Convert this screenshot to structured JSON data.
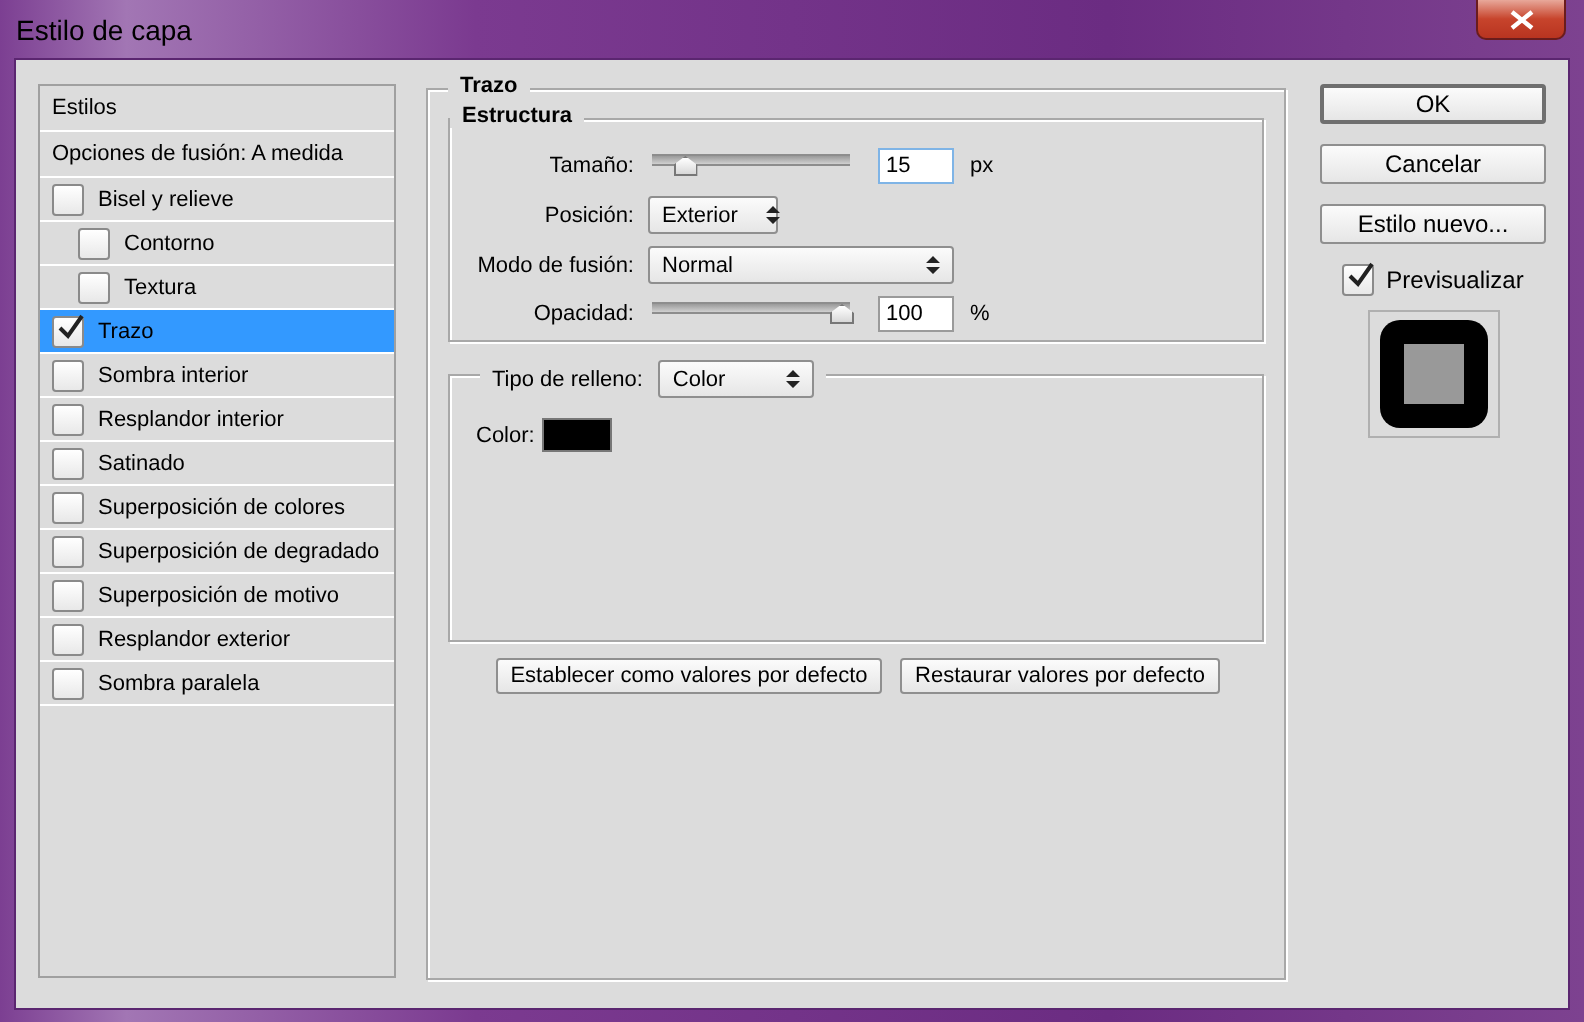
{
  "window": {
    "title": "Estilo de capa"
  },
  "styles_list": {
    "items": [
      {
        "kind": "header",
        "label": "Estilos",
        "selected": false
      },
      {
        "kind": "plain",
        "label": "Opciones de fusión: A medida",
        "selected": false
      },
      {
        "kind": "check",
        "label": "Bisel y relieve",
        "checked": false,
        "selected": false,
        "children": [
          {
            "kind": "check",
            "label": "Contorno",
            "checked": false,
            "selected": false
          },
          {
            "kind": "check",
            "label": "Textura",
            "checked": false,
            "selected": false
          }
        ]
      },
      {
        "kind": "check",
        "label": "Trazo",
        "checked": true,
        "selected": true
      },
      {
        "kind": "check",
        "label": "Sombra interior",
        "checked": false,
        "selected": false
      },
      {
        "kind": "check",
        "label": "Resplandor interior",
        "checked": false,
        "selected": false
      },
      {
        "kind": "check",
        "label": "Satinado",
        "checked": false,
        "selected": false
      },
      {
        "kind": "check",
        "label": "Superposición de colores",
        "checked": false,
        "selected": false
      },
      {
        "kind": "check",
        "label": "Superposición de degradado",
        "checked": false,
        "selected": false
      },
      {
        "kind": "check",
        "label": "Superposición de motivo",
        "checked": false,
        "selected": false
      },
      {
        "kind": "check",
        "label": "Resplandor exterior",
        "checked": false,
        "selected": false
      },
      {
        "kind": "check",
        "label": "Sombra paralela",
        "checked": false,
        "selected": false
      }
    ]
  },
  "stroke": {
    "title": "Trazo",
    "structure": {
      "title": "Estructura",
      "rows": [
        {
          "kind": "slider",
          "label": "Tamaño:",
          "level": 0.12,
          "value": "15",
          "unit": "px",
          "focused": true
        },
        {
          "kind": "select",
          "label": "Posición:",
          "value": "Exterior",
          "wide": false
        },
        {
          "kind": "select",
          "label": "Modo de fusión:",
          "value": "Normal",
          "wide": true
        },
        {
          "kind": "slider",
          "label": "Opacidad:",
          "level": 1,
          "value": "100",
          "unit": "%",
          "focused": false
        }
      ]
    },
    "fill": {
      "label": "Tipo de relleno:",
      "value": "Color",
      "color_label": "Color:",
      "color": "#000000"
    },
    "buttons": [
      "Establecer como valores por defecto",
      "Restaurar valores por defecto"
    ]
  },
  "side": {
    "buttons": [
      {
        "label": "OK",
        "default": true
      },
      {
        "label": "Cancelar",
        "default": false
      },
      {
        "label": "Estilo nuevo...",
        "default": false
      }
    ],
    "preview": {
      "label": "Previsualizar",
      "checked": true
    }
  }
}
